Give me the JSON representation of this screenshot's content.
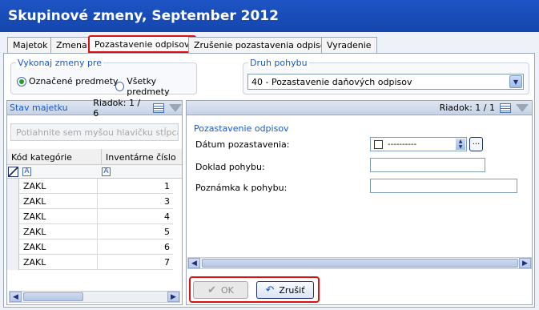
{
  "window": {
    "title": "Skupinové zmeny, September 2012"
  },
  "tabs": [
    "Majetok",
    "Zmena",
    "Pozastavenie odpisov",
    "Zrušenie pozastavenia odpisov",
    "Vyradenie"
  ],
  "active_tab": "Pozastavenie odpisov",
  "execute_group": {
    "label": "Vykonaj zmeny pre",
    "option_marked": "Označené predmety",
    "option_all": "Všetky predmety",
    "selected": "Označené predmety"
  },
  "movement_group": {
    "label": "Druh pohybu",
    "value": "40 - Pozastavenie daňových odpisov"
  },
  "left_panel": {
    "title": "Stav majetku",
    "row_indicator": "Riadok: 1 / 6",
    "drag_hint": "Potiahnite sem myšou hlavičku stĺpca",
    "col_category": "Kód kategórie",
    "col_inventory": "Inventárne číslo",
    "filter_glyph": "A"
  },
  "rows": [
    {
      "category": "ZAKL",
      "number": "1"
    },
    {
      "category": "ZAKL",
      "number": "3"
    },
    {
      "category": "ZAKL",
      "number": "4"
    },
    {
      "category": "ZAKL",
      "number": "5"
    },
    {
      "category": "ZAKL",
      "number": "6"
    },
    {
      "category": "ZAKL",
      "number": "7"
    }
  ],
  "right_panel": {
    "row_indicator": "Riadok: 1 / 1",
    "section_title": "Pozastavenie odpisov",
    "date_label": "Dátum pozastavenia:",
    "date_value": "----------",
    "doc_label": "Doklad pohybu:",
    "note_label": "Poznámka k pohybu:"
  },
  "buttons": {
    "ok": "OK",
    "cancel": "Zrušiť"
  },
  "colors": {
    "title_bar": "#1a4fc0",
    "highlight": "#e01010",
    "section_text": "#1a57c6"
  }
}
